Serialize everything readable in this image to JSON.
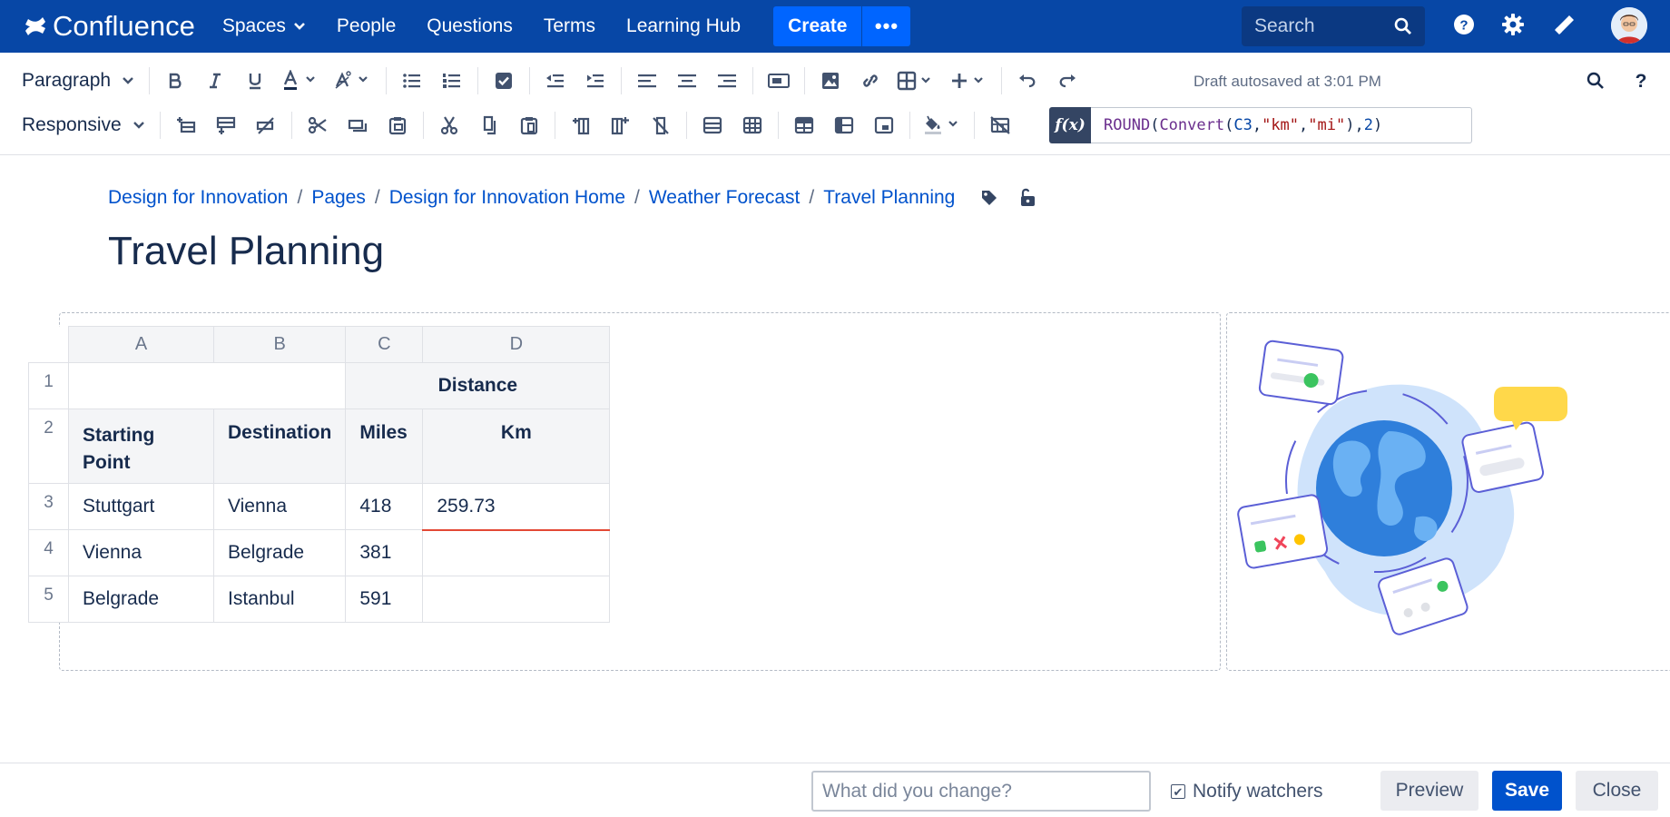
{
  "nav": {
    "brand": "Confluence",
    "items": [
      "Spaces",
      "People",
      "Questions",
      "Terms",
      "Learning Hub"
    ],
    "create_label": "Create",
    "more_label": "•••",
    "search_placeholder": "Search",
    "brand_color": "#0747a6",
    "accent_color": "#0065ff"
  },
  "toolbar": {
    "style_dropdown": "Paragraph",
    "layout_dropdown": "Responsive",
    "autosave_text": "Draft autosaved at 3:01 PM",
    "formula_label": "f(x)",
    "formula": {
      "fn1": "ROUND",
      "p1": "(",
      "fn2": "Convert",
      "p2": "(",
      "ref": "C3",
      "c1": ",",
      "s1": "\"km\"",
      "c2": ",",
      "s2": "\"mi\"",
      "p3": ")",
      "c3": ",",
      "num": "2",
      "p4": ")"
    }
  },
  "breadcrumbs": [
    "Design for Innovation",
    "Pages",
    "Design for Innovation Home",
    "Weather Forecast",
    "Travel Planning"
  ],
  "page_title": "Travel Planning",
  "sheet": {
    "columns": [
      "A",
      "B",
      "C",
      "D"
    ],
    "rows": [
      "1",
      "2",
      "3",
      "4",
      "5"
    ],
    "header_distance": "Distance",
    "header_start": "Starting Point",
    "header_dest": "Destination",
    "header_miles": "Miles",
    "header_km": "Km",
    "data": [
      {
        "start": "Stuttgart",
        "dest": "Vienna",
        "miles": "418",
        "km": "259.73"
      },
      {
        "start": "Vienna",
        "dest": "Belgrade",
        "miles": "381",
        "km": ""
      },
      {
        "start": "Belgrade",
        "dest": "Istanbul",
        "miles": "591",
        "km": ""
      }
    ]
  },
  "footer": {
    "change_placeholder": "What did you change?",
    "notify_label": "Notify watchers",
    "notify_checked": true,
    "preview_label": "Preview",
    "save_label": "Save",
    "close_label": "Close"
  }
}
